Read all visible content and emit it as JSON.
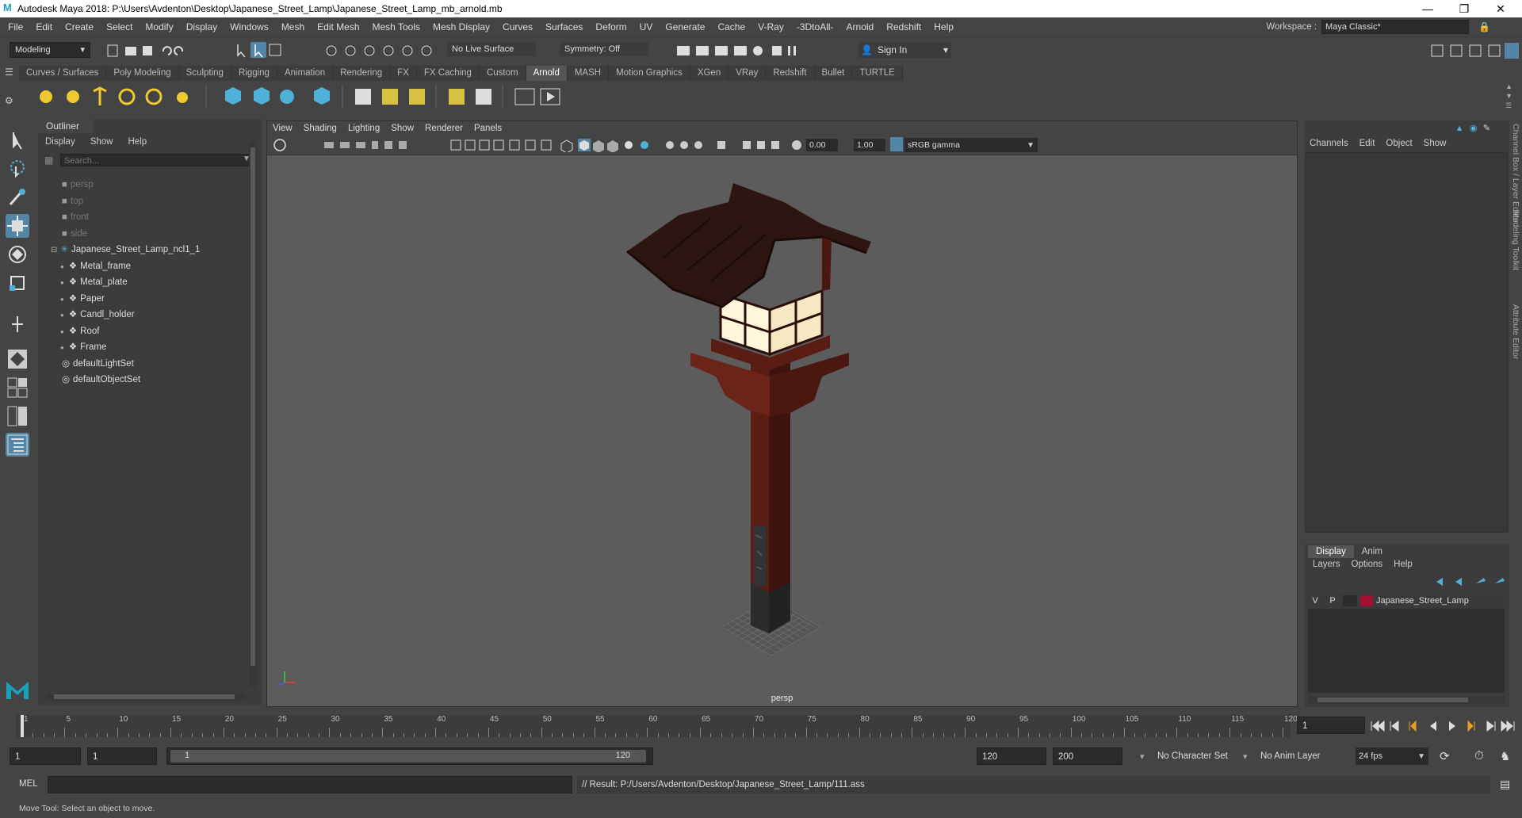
{
  "window": {
    "title": "Autodesk Maya 2018: P:\\Users\\Avdenton\\Desktop\\Japanese_Street_Lamp\\Japanese_Street_Lamp_mb_arnold.mb"
  },
  "menubar": [
    "File",
    "Edit",
    "Create",
    "Select",
    "Modify",
    "Display",
    "Windows",
    "Mesh",
    "Edit Mesh",
    "Mesh Tools",
    "Mesh Display",
    "Curves",
    "Surfaces",
    "Deform",
    "UV",
    "Generate",
    "Cache",
    "V-Ray",
    "-3DtoAll-",
    "Arnold",
    "Redshift",
    "Help"
  ],
  "workspace": {
    "label": "Workspace :",
    "value": "Maya Classic*"
  },
  "statusline": {
    "mode": "Modeling",
    "live_surface": "No Live Surface",
    "symmetry": "Symmetry: Off",
    "sign_in": "Sign In"
  },
  "shelf": {
    "tabs": [
      "Curves / Surfaces",
      "Poly Modeling",
      "Sculpting",
      "Rigging",
      "Animation",
      "Rendering",
      "FX",
      "FX Caching",
      "Custom",
      "Arnold",
      "MASH",
      "Motion Graphics",
      "XGen",
      "VRay",
      "Redshift",
      "Bullet",
      "TURTLE"
    ],
    "active": "Arnold"
  },
  "outliner": {
    "title": "Outliner",
    "menu": [
      "Display",
      "Show",
      "Help"
    ],
    "search_placeholder": "Search...",
    "items": [
      {
        "label": "persp",
        "type": "camera",
        "indent": 0,
        "dim": true
      },
      {
        "label": "top",
        "type": "camera",
        "indent": 0,
        "dim": true
      },
      {
        "label": "front",
        "type": "camera",
        "indent": 0,
        "dim": true
      },
      {
        "label": "side",
        "type": "camera",
        "indent": 0,
        "dim": true
      },
      {
        "label": "Japanese_Street_Lamp_ncl1_1",
        "type": "group",
        "indent": 0,
        "dim": false
      },
      {
        "label": "Metal_frame",
        "type": "mesh",
        "indent": 1,
        "dim": false
      },
      {
        "label": "Metal_plate",
        "type": "mesh",
        "indent": 1,
        "dim": false
      },
      {
        "label": "Paper",
        "type": "mesh",
        "indent": 1,
        "dim": false
      },
      {
        "label": "Candl_holder",
        "type": "mesh",
        "indent": 1,
        "dim": false
      },
      {
        "label": "Roof",
        "type": "mesh",
        "indent": 1,
        "dim": false
      },
      {
        "label": "Frame",
        "type": "mesh",
        "indent": 1,
        "dim": false
      },
      {
        "label": "defaultLightSet",
        "type": "set",
        "indent": 0,
        "dim": false
      },
      {
        "label": "defaultObjectSet",
        "type": "set",
        "indent": 0,
        "dim": false
      }
    ]
  },
  "viewport": {
    "menu": [
      "View",
      "Shading",
      "Lighting",
      "Show",
      "Renderer",
      "Panels"
    ],
    "exposure": "0.00",
    "gamma": "1.00",
    "color_space": "sRGB gamma",
    "camera": "persp"
  },
  "channelbox": {
    "menu": [
      "Channels",
      "Edit",
      "Object",
      "Show"
    ]
  },
  "side_tabs": [
    "Channel Box / Layer Editor",
    "Modeling Toolkit",
    "Attribute Editor"
  ],
  "layers": {
    "tabs": [
      "Display",
      "Anim"
    ],
    "active_tab": "Display",
    "menu": [
      "Layers",
      "Options",
      "Help"
    ],
    "layer": {
      "v": "V",
      "p": "P",
      "name": "Japanese_Street_Lamp",
      "color": "#a01030"
    }
  },
  "timeline": {
    "ticks": [
      "1",
      "5",
      "10",
      "15",
      "20",
      "25",
      "30",
      "35",
      "40",
      "45",
      "50",
      "55",
      "60",
      "65",
      "70",
      "75",
      "80",
      "85",
      "90",
      "95",
      "100",
      "105",
      "110",
      "115",
      "120"
    ],
    "current_frame": "1"
  },
  "range": {
    "start": "1",
    "playback_start": "1",
    "slider_start": "1",
    "slider_end": "120",
    "playback_end": "120",
    "end": "200",
    "character_set": "No Character Set",
    "anim_layer": "No Anim Layer",
    "fps": "24 fps"
  },
  "mel": {
    "label": "MEL",
    "result": "// Result: P:/Users/Avdenton/Desktop/Japanese_Street_Lamp/111.ass"
  },
  "helpline": "Move Tool: Select an object to move."
}
